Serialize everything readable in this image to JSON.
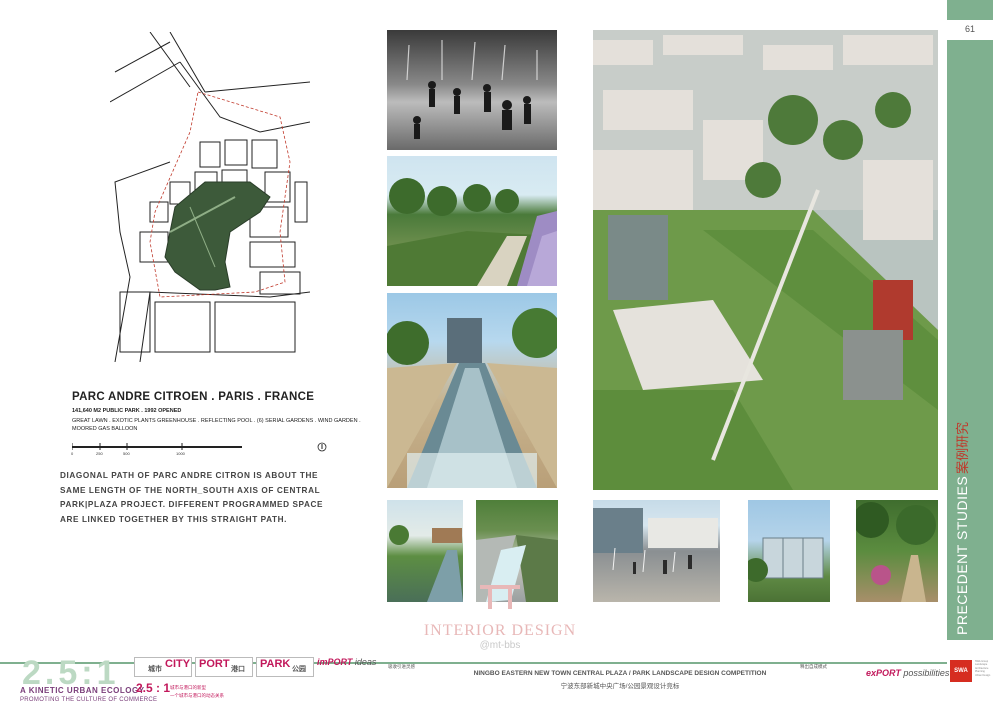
{
  "page": {
    "number": "61"
  },
  "side": {
    "title_en": "PRECEDENT STUDIES",
    "title_cn": "案例研究"
  },
  "caption": {
    "title": "PARC ANDRE CITROEN . PARIS . FRANCE",
    "sub": "141,640 M2 PUBLIC PARK . 1992 OPENED",
    "desc_line1": "GREAT LAWN . EXOTIC PLANTS GREENHOUSE . REFLECTING POOL . (6) SERIAL GARDENS . WIND GARDEN .",
    "desc_line2": "MOORED GAS BALLOON"
  },
  "scale": {
    "labels": [
      "0",
      "250",
      "500",
      "1000"
    ]
  },
  "description": [
    "DIAGONAL PATH OF PARC ANDRE CITRON IS ABOUT THE",
    "SAME LENGTH OF THE NORTH_SOUTH AXIS OF CENTRAL",
    "PARK|PLAZA PROJECT. DIFFERENT PROGRAMMED SPACE",
    "ARE LINKED TOGETHER BY THIS STRAIGHT PATH."
  ],
  "watermark": {
    "title": "INTERIOR DESIGN",
    "sub": "@mt-bbs"
  },
  "footer": {
    "brand_big": "2.5:1",
    "brand_line1": "A KINETIC URBAN ECOLOGY",
    "brand_line2": "PROMOTING THE CULTURE OF COMMERCE",
    "tags": [
      {
        "en": "CITY",
        "cn": "城市"
      },
      {
        "en": "PORT",
        "cn": "港口"
      },
      {
        "en": "PARK",
        "cn": "公园"
      }
    ],
    "mini_num": "2.5 : 1",
    "mini_cn1": "城市与港口的新型",
    "mini_cn2": "一个城市与港口的动态关系",
    "import_prefix": "imPORT",
    "import_suffix": "ideas",
    "import_cn": "吸收引进灵感",
    "comp_en": "NINGBO EASTERN NEW TOWN CENTRAL PLAZA / PARK LANDSCAPE DESIGN COMPETITION",
    "comp_cn": "宁波东部新城中央广场/公园景观设计竞标",
    "export_cn": "释出自成模式",
    "export_prefix": "exPORT",
    "export_suffix": "possibilities",
    "logo": "SWA",
    "logo_lines": [
      "SWA Group",
      "Landscape",
      "Architecture",
      "Planning",
      "Urban Design"
    ]
  },
  "colors": {
    "accent": "#7fb08f",
    "brand": "#c2185b",
    "red": "#c0392b"
  }
}
